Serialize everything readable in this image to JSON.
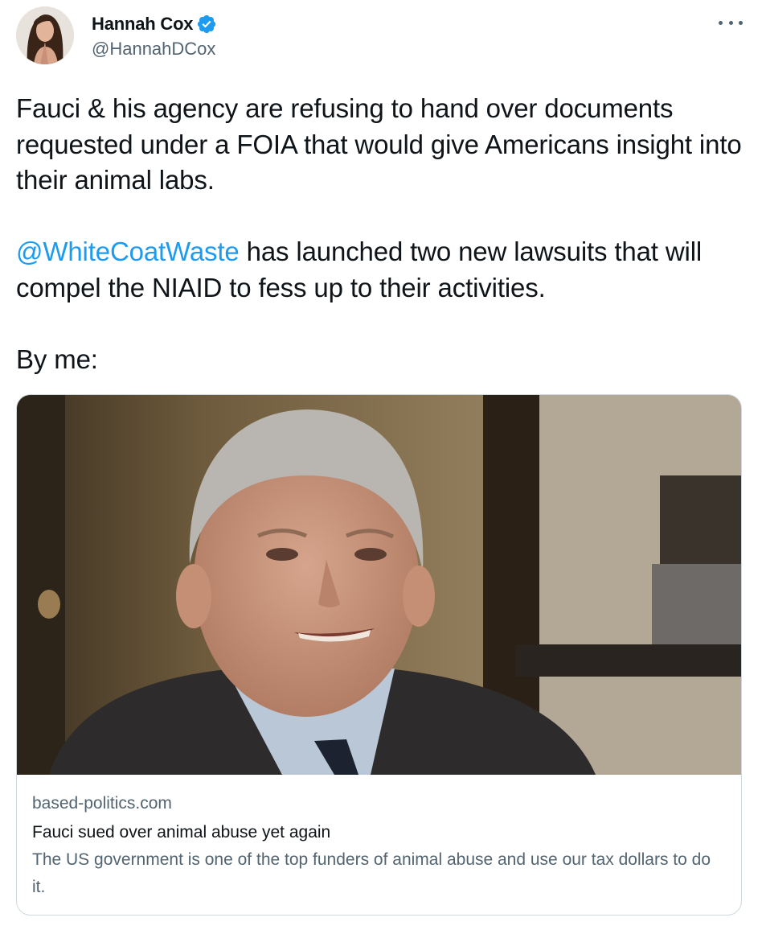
{
  "author": {
    "display_name": "Hannah Cox",
    "handle": "@HannahDCox",
    "verified": true,
    "avatar_icon": "profile-photo"
  },
  "menu": {
    "icon": "more-options-icon"
  },
  "tweet": {
    "paragraph_1": "Fauci & his agency are refusing to hand over documents requested under a FOIA that would give Americans insight into their animal labs.",
    "mention": "@WhiteCoatWaste",
    "paragraph_2_rest": " has launched two new lawsuits that will compel the NIAID to fess up to their activities.",
    "paragraph_3": "By me:"
  },
  "card": {
    "domain": "based-politics.com",
    "title": "Fauci sued over animal abuse yet again",
    "description": "The US government is one of the top funders of animal abuse and use our tax dollars to do it."
  },
  "colors": {
    "text": "#0f1419",
    "secondary": "#536471",
    "link": "#1d9bf0",
    "border": "#cfd9de"
  }
}
